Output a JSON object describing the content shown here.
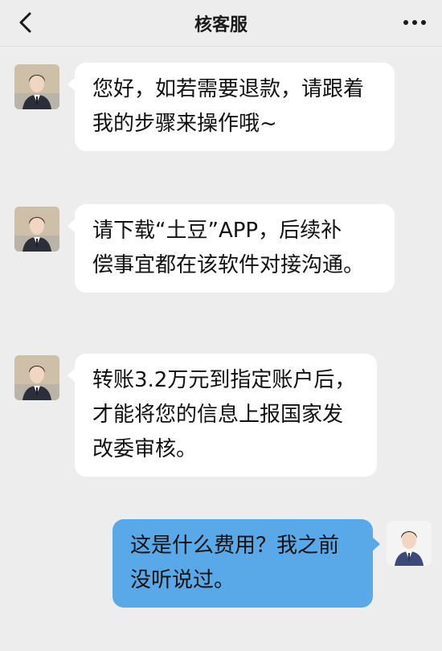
{
  "header": {
    "title": "核客服",
    "back_icon": "chevron-left-icon",
    "more_icon": "more-horizontal-icon"
  },
  "messages": [
    {
      "sender": "service",
      "lines": [
        "您好，如若需要退款，请跟着",
        "我的步骤来操作哦~"
      ]
    },
    {
      "sender": "service",
      "lines": [
        "请下载“土豆”APP，后续补",
        "偿事宜都在该软件对接沟通。"
      ]
    },
    {
      "sender": "service",
      "lines": [
        "转账3.2万元到指定账户后，",
        "才能将您的信息上报国家发",
        "改委审核。"
      ]
    },
    {
      "sender": "user",
      "lines": [
        "这是什么费用？我之前",
        "没听说过。"
      ]
    }
  ],
  "colors": {
    "background": "#ededed",
    "incoming_bubble": "#ffffff",
    "outgoing_bubble": "#59a9e8"
  }
}
